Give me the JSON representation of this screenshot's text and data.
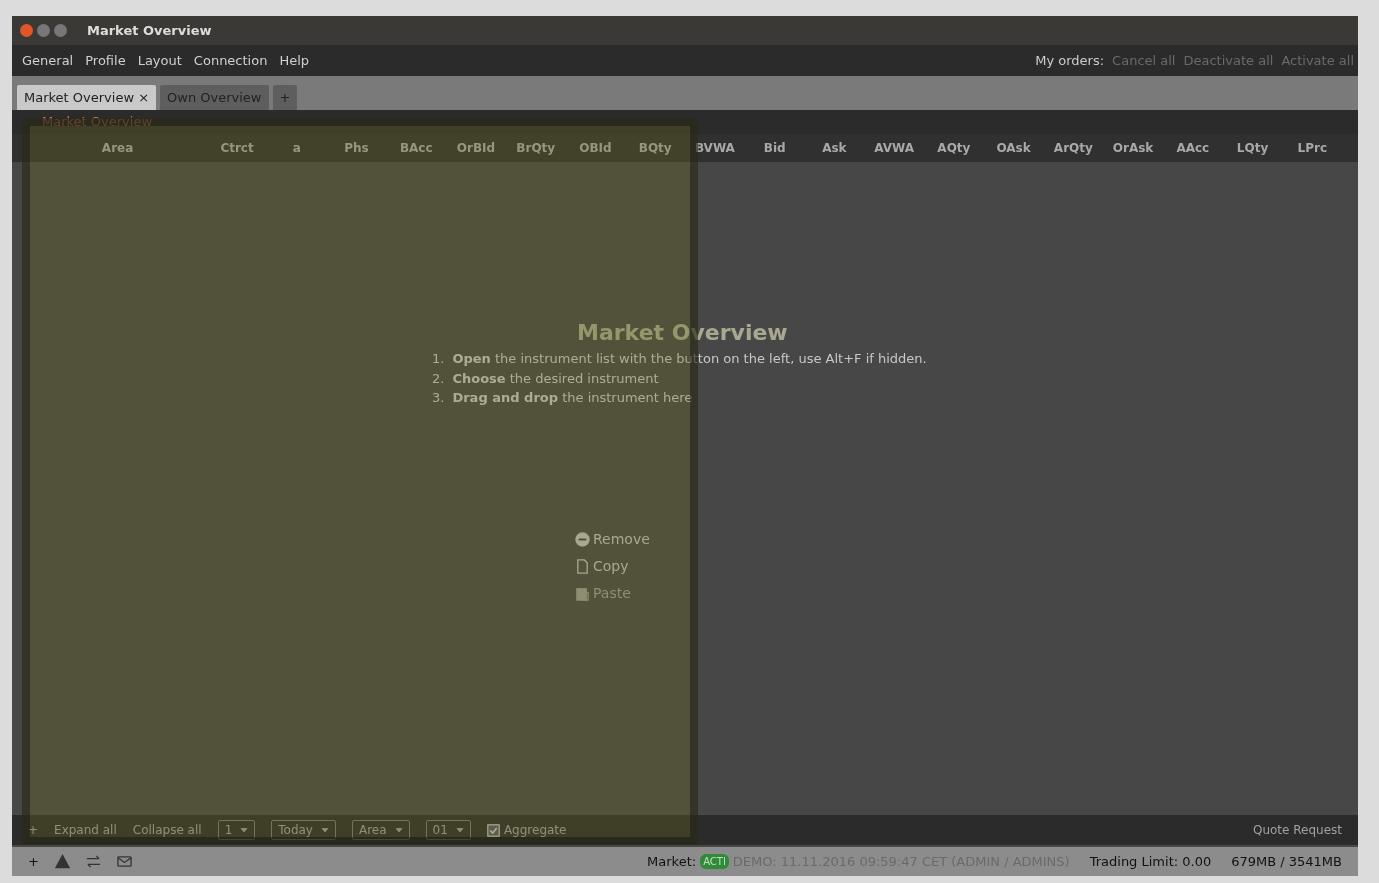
{
  "window": {
    "title": "Market Overview"
  },
  "menu": [
    "General",
    "Profile",
    "Layout",
    "Connection",
    "Help"
  ],
  "my_orders": {
    "label": "My orders:",
    "actions": [
      "Cancel all",
      "Deactivate all",
      "Activate all"
    ]
  },
  "tabs": [
    {
      "label": "Market Overview",
      "selected": true,
      "close": "×"
    },
    {
      "label": "Own Overview",
      "selected": false
    }
  ],
  "add_tab": "+",
  "panel_title": "Market Overview",
  "columns": [
    "Area",
    "Ctrct",
    "a",
    "Phs",
    "BAcc",
    "OrBId",
    "BrQty",
    "OBId",
    "BQty",
    "BVWA",
    "Bid",
    "Ask",
    "AVWA",
    "AQty",
    "OAsk",
    "ArQty",
    "OrAsk",
    "AAcc",
    "LQty",
    "LPrc"
  ],
  "empty_state": {
    "title": "Market Overview",
    "hints": [
      {
        "number": "1.",
        "text": "**Open** the instrument list with the button on the left, use Alt+F if hidden."
      },
      {
        "number": "2.",
        "text": "**Choose** the desired instrument"
      },
      {
        "number": "3.",
        "text": "**Drag and drop** the instrument here"
      }
    ]
  },
  "context_menu": [
    {
      "kind": "remove",
      "label": "Remove",
      "disabled": false
    },
    {
      "kind": "copy",
      "label": "Copy",
      "disabled": false
    },
    {
      "kind": "paste",
      "label": "Paste",
      "disabled": true
    }
  ],
  "toolbar": {
    "add": "+",
    "expand": "Expand all",
    "collapse": "Collapse all",
    "dropdowns": [
      "1",
      "Today",
      "Area",
      "01"
    ],
    "aggregate": {
      "label": "Aggregate",
      "checked": true
    },
    "quote_request": "Quote Request"
  },
  "status_bar": {
    "add": "+",
    "market_label": "Market:",
    "market_state": "ACTI",
    "session": "DEMO: 11.11.2016 09:59:47 CET (ADMIN / ADMINS)",
    "trading_limit": "Trading Limit: 0.00",
    "memory": "679MB / 3541MB"
  }
}
